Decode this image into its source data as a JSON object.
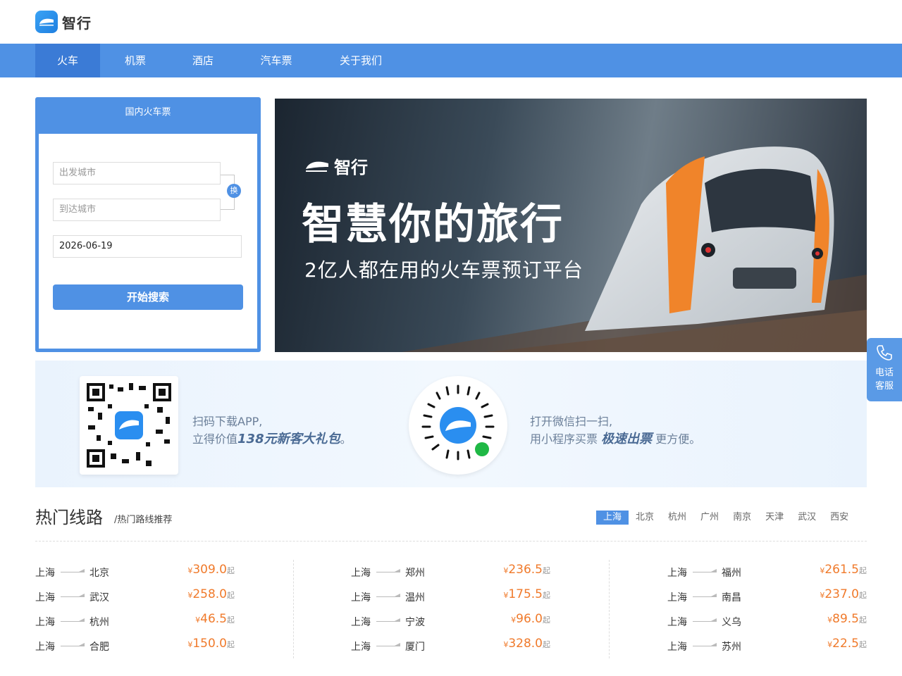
{
  "brand": {
    "name": "智行"
  },
  "nav": {
    "items": [
      "火车",
      "机票",
      "酒店",
      "汽车票",
      "关于我们"
    ],
    "active": "火车"
  },
  "search": {
    "title": "国内火车票",
    "from_placeholder": "出发城市",
    "to_placeholder": "到达城市",
    "swap_label": "换",
    "date_value": "2026-06-19",
    "submit_label": "开始搜索"
  },
  "banner": {
    "brand": "智行",
    "slogan": "智慧你的旅行",
    "subtitle": "2亿人都在用的火车票预订平台"
  },
  "side_service": {
    "line1": "电话",
    "line2": "客服"
  },
  "promo": {
    "app_line1": "扫码下载APP,",
    "app_line2_prefix": "立得价值",
    "app_line2_highlight": "138元新客大礼包",
    "app_line2_suffix": "。",
    "mini_line1": "打开微信扫一扫,",
    "mini_line2_prefix": "用小程序买票",
    "mini_line2_highlight": "极速出票",
    "mini_line2_suffix": "更方便。"
  },
  "hot": {
    "title": "热门线路",
    "subtitle": "/热门路线推荐",
    "cities": [
      "上海",
      "北京",
      "杭州",
      "广州",
      "南京",
      "天津",
      "武汉",
      "西安"
    ],
    "active_city": "上海",
    "currency": "¥",
    "suffix": "起",
    "columns": [
      [
        {
          "from": "上海",
          "to": "北京",
          "price": "309.0"
        },
        {
          "from": "上海",
          "to": "武汉",
          "price": "258.0"
        },
        {
          "from": "上海",
          "to": "杭州",
          "price": "46.5"
        },
        {
          "from": "上海",
          "to": "合肥",
          "price": "150.0"
        }
      ],
      [
        {
          "from": "上海",
          "to": "郑州",
          "price": "236.5"
        },
        {
          "from": "上海",
          "to": "温州",
          "price": "175.5"
        },
        {
          "from": "上海",
          "to": "宁波",
          "price": "96.0"
        },
        {
          "from": "上海",
          "to": "厦门",
          "price": "328.0"
        }
      ],
      [
        {
          "from": "上海",
          "to": "福州",
          "price": "261.5"
        },
        {
          "from": "上海",
          "to": "南昌",
          "price": "237.0"
        },
        {
          "from": "上海",
          "to": "义乌",
          "price": "89.5"
        },
        {
          "from": "上海",
          "to": "苏州",
          "price": "22.5"
        }
      ]
    ]
  }
}
